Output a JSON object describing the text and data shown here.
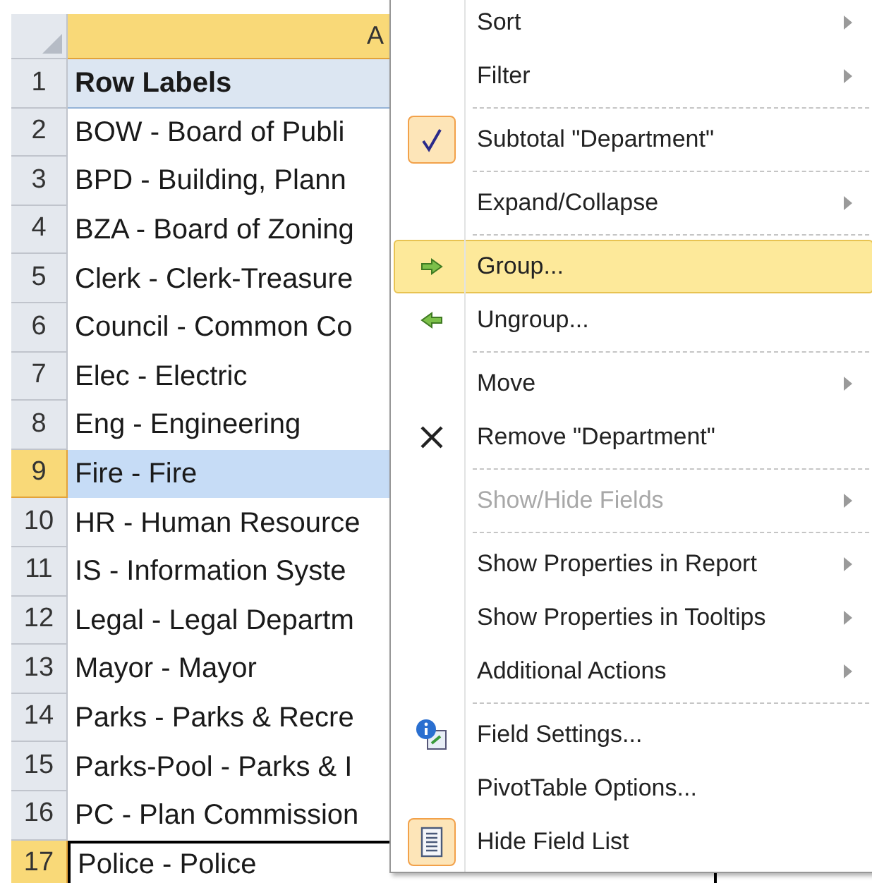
{
  "sheet": {
    "column_header": "A",
    "selected_column": true,
    "rows": [
      {
        "number": "1",
        "label": "Row Labels",
        "kind": "header",
        "selected": false,
        "active": false
      },
      {
        "number": "2",
        "label": "BOW - Board of Publi",
        "kind": "item",
        "selected": false,
        "active": false
      },
      {
        "number": "3",
        "label": "BPD - Building, Plann",
        "kind": "item",
        "selected": false,
        "active": false
      },
      {
        "number": "4",
        "label": "BZA - Board of Zoning",
        "kind": "item",
        "selected": false,
        "active": false
      },
      {
        "number": "5",
        "label": "Clerk - Clerk-Treasure",
        "kind": "item",
        "selected": false,
        "active": false
      },
      {
        "number": "6",
        "label": "Council - Common Co",
        "kind": "item",
        "selected": false,
        "active": false
      },
      {
        "number": "7",
        "label": "Elec - Electric",
        "kind": "item",
        "selected": false,
        "active": false
      },
      {
        "number": "8",
        "label": "Eng - Engineering",
        "kind": "item",
        "selected": false,
        "active": false
      },
      {
        "number": "9",
        "label": "Fire - Fire",
        "kind": "item",
        "selected": true,
        "active": false
      },
      {
        "number": "10",
        "label": "HR - Human Resource",
        "kind": "item",
        "selected": false,
        "active": false
      },
      {
        "number": "11",
        "label": "IS - Information Syste",
        "kind": "item",
        "selected": false,
        "active": false
      },
      {
        "number": "12",
        "label": "Legal - Legal Departm",
        "kind": "item",
        "selected": false,
        "active": false
      },
      {
        "number": "13",
        "label": "Mayor - Mayor",
        "kind": "item",
        "selected": false,
        "active": false
      },
      {
        "number": "14",
        "label": "Parks - Parks & Recre",
        "kind": "item",
        "selected": false,
        "active": false
      },
      {
        "number": "15",
        "label": "Parks-Pool - Parks & I",
        "kind": "item",
        "selected": false,
        "active": false
      },
      {
        "number": "16",
        "label": "PC - Plan Commission",
        "kind": "item",
        "selected": false,
        "active": false
      },
      {
        "number": "17",
        "label": "Police - Police",
        "kind": "item",
        "selected": false,
        "active": true
      }
    ]
  },
  "context_menu": {
    "items": [
      {
        "kind": "plain",
        "label": "Sort",
        "submenu": true,
        "disabled": false,
        "checked": false,
        "selected": false
      },
      {
        "kind": "plain",
        "label": "Filter",
        "submenu": true,
        "disabled": false,
        "checked": false,
        "selected": false
      },
      {
        "kind": "separator"
      },
      {
        "kind": "check",
        "label": "Subtotal \"Department\"",
        "submenu": false,
        "disabled": false,
        "checked": true,
        "selected": false
      },
      {
        "kind": "separator"
      },
      {
        "kind": "plain",
        "label": "Expand/Collapse",
        "submenu": true,
        "disabled": false,
        "checked": false,
        "selected": false
      },
      {
        "kind": "separator"
      },
      {
        "kind": "group",
        "label": "Group...",
        "submenu": false,
        "disabled": false,
        "checked": false,
        "selected": true
      },
      {
        "kind": "ungroup",
        "label": "Ungroup...",
        "submenu": false,
        "disabled": false,
        "checked": false,
        "selected": false
      },
      {
        "kind": "separator"
      },
      {
        "kind": "plain",
        "label": "Move",
        "submenu": true,
        "disabled": false,
        "checked": false,
        "selected": false
      },
      {
        "kind": "remove",
        "label": "Remove \"Department\"",
        "submenu": false,
        "disabled": false,
        "checked": false,
        "selected": false
      },
      {
        "kind": "separator"
      },
      {
        "kind": "plain",
        "label": "Show/Hide Fields",
        "submenu": true,
        "disabled": true,
        "checked": false,
        "selected": false
      },
      {
        "kind": "separator"
      },
      {
        "kind": "plain",
        "label": "Show Properties in Report",
        "submenu": true,
        "disabled": false,
        "checked": false,
        "selected": false
      },
      {
        "kind": "plain",
        "label": "Show Properties in Tooltips",
        "submenu": true,
        "disabled": false,
        "checked": false,
        "selected": false
      },
      {
        "kind": "plain",
        "label": "Additional Actions",
        "submenu": true,
        "disabled": false,
        "checked": false,
        "selected": false
      },
      {
        "kind": "separator"
      },
      {
        "kind": "settings",
        "label": "Field Settings...",
        "submenu": false,
        "disabled": false,
        "checked": false,
        "selected": false
      },
      {
        "kind": "plain",
        "label": "PivotTable Options...",
        "submenu": false,
        "disabled": false,
        "checked": false,
        "selected": false
      },
      {
        "kind": "fieldlist",
        "label": "Hide Field List",
        "submenu": false,
        "disabled": false,
        "checked": true,
        "selected": false
      }
    ]
  }
}
